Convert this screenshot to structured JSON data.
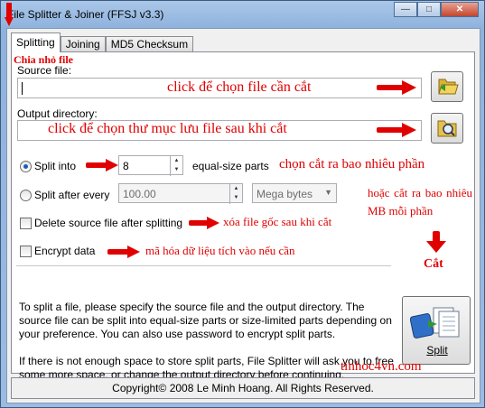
{
  "window": {
    "title": "File Splitter & Joiner (FFSJ v3.3)"
  },
  "tabs": [
    {
      "label": "Splitting"
    },
    {
      "label": "Joining"
    },
    {
      "label": "MD5 Checksum"
    }
  ],
  "annotations": {
    "tab_note": "Chia nhỏ file",
    "source_note": "click để chọn file cần cắt",
    "output_note": "click để chọn thư mục lưu file sau khi cắt",
    "parts_note": "chọn cắt ra bao nhiêu phần",
    "size_note": "hoặc cắt ra bao nhiêu MB mỗi phần",
    "delete_note": "xóa file gốc sau khi cắt",
    "encrypt_note": "mã hóa dữ liệu tích vào nếu cần",
    "split_note": "Cắt",
    "watermark": "tinhoc4vn.com"
  },
  "form": {
    "source_label": "Source file:",
    "source_value": "",
    "output_label": "Output directory:",
    "output_value": "",
    "split_into_label": "Split into",
    "split_into_value": "8",
    "equal_parts_label": "equal-size parts",
    "split_after_label": "Split after every",
    "split_after_value": "100.00",
    "unit_selected": "Mega bytes",
    "delete_label": "Delete source file after splitting",
    "encrypt_label": "Encrypt data"
  },
  "info": {
    "para1": "To split a file, please specify the source file and the output directory. The source file can be split into equal-size parts or size-limited parts depending on your preference. You can also use password to encrypt split parts.",
    "para2": "If there is not enough space to store split parts, File Splitter will ask you to free some more space, or change the output directory before continuing."
  },
  "split_button": {
    "label": "Split"
  },
  "status": {
    "copyright": "Copyright© 2008 Le Minh Hoang. All Rights Reserved."
  },
  "colors": {
    "annotation_red": "#e00000",
    "radio_accent": "#1a5eb5"
  },
  "icons": {
    "source_browse": "folder-open-icon",
    "output_browse": "folder-search-icon",
    "split": "split-files-icon"
  }
}
